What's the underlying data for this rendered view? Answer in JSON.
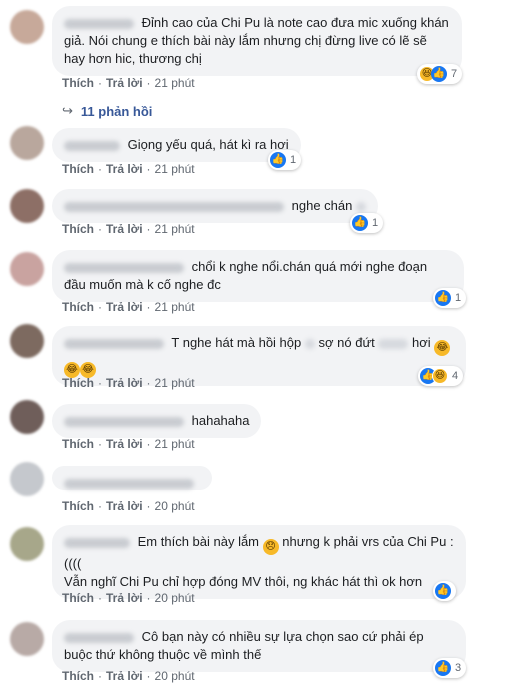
{
  "labels": {
    "like": "Thích",
    "reply": "Trả lời",
    "dot": "·"
  },
  "replies_link": {
    "icon": "reply-arrow-icon",
    "text": "11 phản hồi"
  },
  "comments": [
    {
      "avatar_color": "#c7a99a",
      "text": "Đỉnh cao của Chi Pu là note cao đưa mic xuống khán giả. Nói chung e thích bài này lắm nhưng chị đừng live có lẽ sẽ hay hơn hic, thương chị",
      "time": "21 phút",
      "reactions": {
        "icons": [
          "haha-icon",
          "like-icon"
        ],
        "count": "7"
      }
    },
    {
      "avatar_color": "#b9a79d",
      "text": "Giọng yếu quá, hát kì ra hơi",
      "time": "21 phút",
      "reactions": {
        "icons": [
          "like-icon"
        ],
        "count": "1"
      }
    },
    {
      "avatar_color": "#8d6f66",
      "text": "nghe chán",
      "time": "21 phút",
      "reactions": {
        "icons": [
          "like-icon"
        ],
        "count": "1"
      }
    },
    {
      "avatar_color": "#c9a3a0",
      "text": "chổi k nghe nổi.chán quá mới nghe đoạn đầu muốn mà k cố nghe đc",
      "time": "21 phút",
      "reactions": {
        "icons": [
          "like-icon"
        ],
        "count": "1"
      }
    },
    {
      "avatar_color": "#7d6a60",
      "text_parts": [
        "T nghe hát mà hồi hộp",
        "sợ nó đứt",
        "hơi"
      ],
      "time": "21 phút",
      "reactions": {
        "icons": [
          "like-icon",
          "haha-icon"
        ],
        "count": "4"
      }
    },
    {
      "avatar_color": "#6f5e5a",
      "text": "hahahaha",
      "time": "21 phút",
      "reactions": null
    },
    {
      "avatar_color": "#c5c8cd",
      "text": "",
      "time": "20 phút",
      "reactions": null
    },
    {
      "avatar_color": "#a7a78a",
      "text_a": "Em thích bài này lắm",
      "text_b": "nhưng k phải vrs của Chi Pu :((((",
      "text_c": "Vẫn nghĩ Chi Pu chỉ hợp đóng MV thôi, ng khác hát thì ok hơn",
      "time": "20 phút",
      "reactions": {
        "icons": [
          "like-icon"
        ],
        "count": ""
      }
    },
    {
      "avatar_color": "#b8aaa6",
      "text": "Cô bạn này có nhiều sự lựa chọn sao cứ phải ép buộc thứ không thuộc về mình thế",
      "time": "20 phút",
      "reactions": {
        "icons": [
          "like-icon"
        ],
        "count": "3"
      }
    }
  ]
}
